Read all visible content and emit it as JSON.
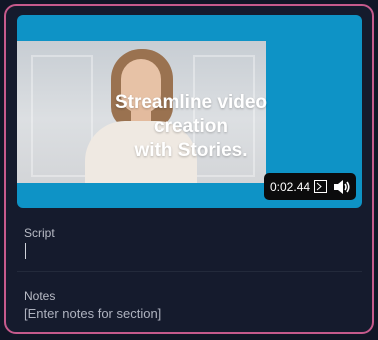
{
  "video": {
    "overlay_title": "Streamline video\ncreation\nwith Stories.",
    "timecode": "0:02.44",
    "accent_color": "#0e93c6"
  },
  "script": {
    "label": "Script",
    "value": ""
  },
  "notes": {
    "label": "Notes",
    "value": "[Enter notes for section]"
  },
  "colors": {
    "card_border": "#c65a8c",
    "background": "#111626"
  },
  "icons": {
    "caption": "caption-icon",
    "volume": "volume-icon"
  }
}
